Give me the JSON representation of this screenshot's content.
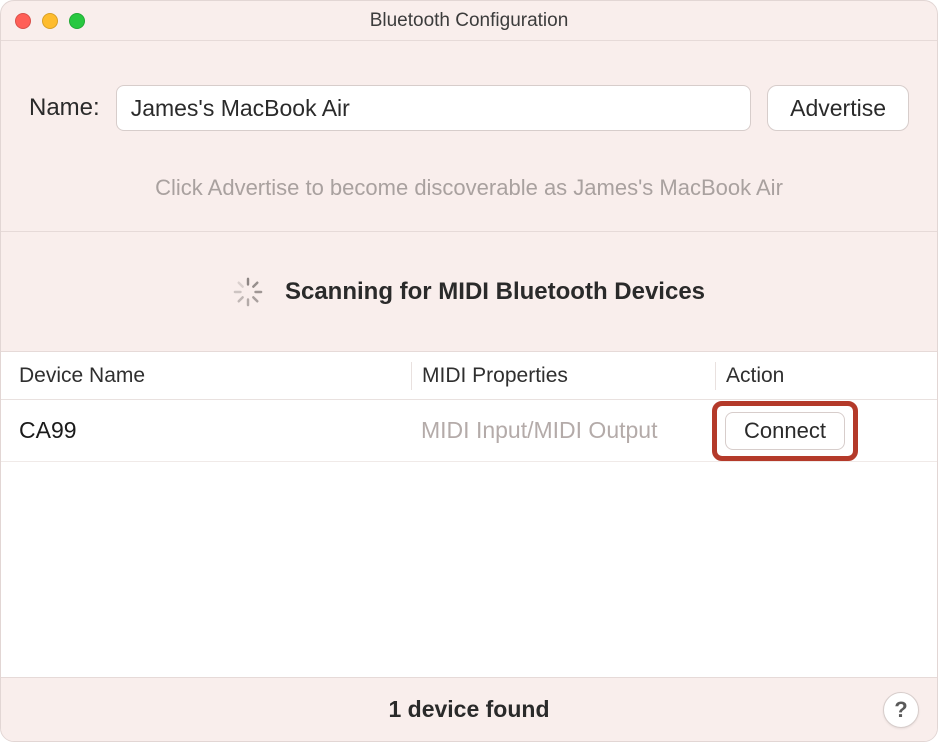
{
  "window": {
    "title": "Bluetooth Configuration"
  },
  "top": {
    "name_label": "Name:",
    "name_value": "James's MacBook Air",
    "advertise_label": "Advertise",
    "hint": "Click Advertise to become discoverable as James's MacBook Air"
  },
  "scan": {
    "text": "Scanning for MIDI Bluetooth Devices"
  },
  "table": {
    "headers": {
      "device": "Device Name",
      "midi": "MIDI Properties",
      "action": "Action"
    },
    "rows": [
      {
        "device": "CA99",
        "midi": "MIDI Input/MIDI Output",
        "action_label": "Connect"
      }
    ]
  },
  "footer": {
    "status": "1 device found",
    "help": "?"
  }
}
